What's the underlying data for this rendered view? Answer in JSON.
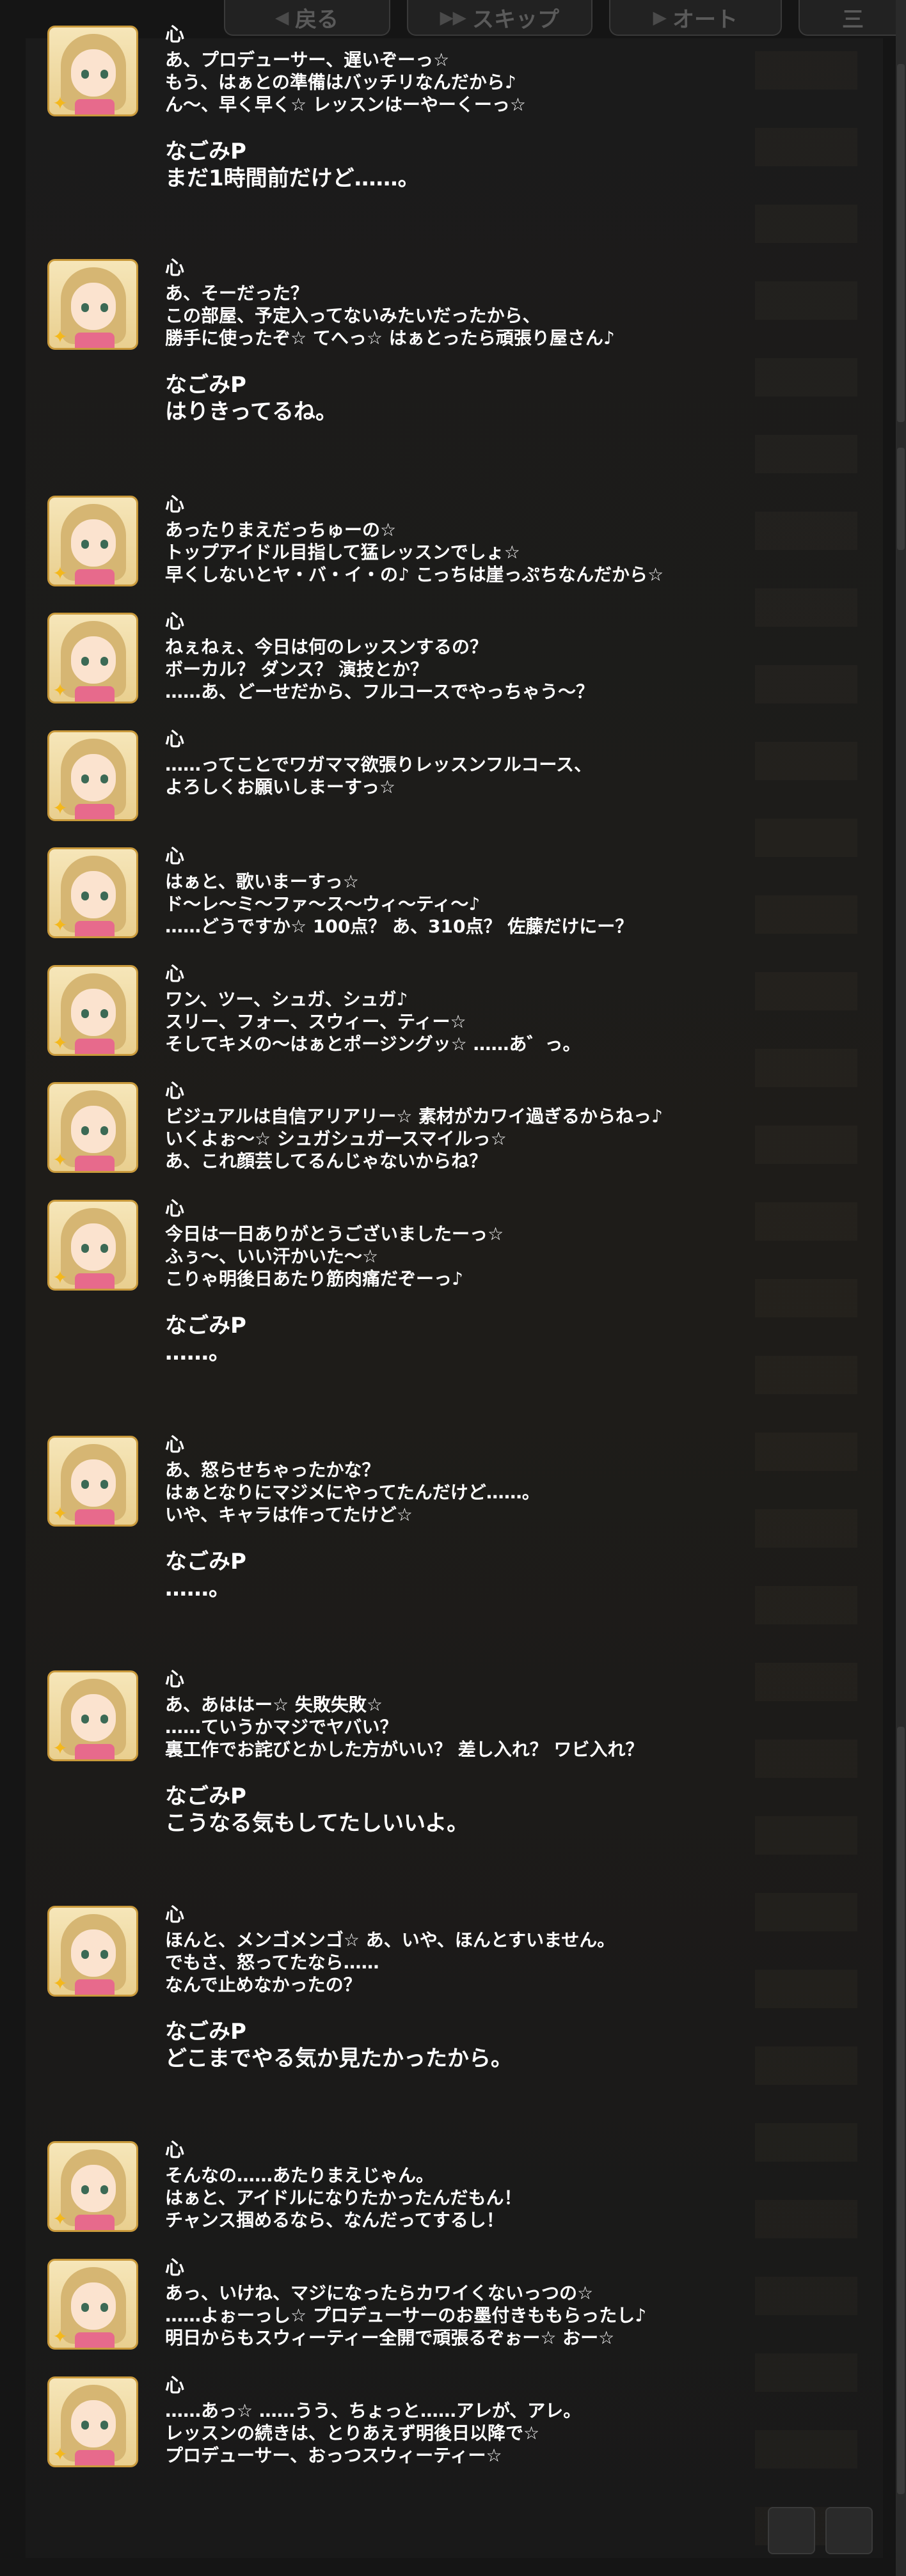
{
  "toolbar": {
    "back_label": "戻る",
    "skip_label": "スキップ",
    "auto_label": "オート",
    "menu_label": "三",
    "back_icon": "back-arrow-icon",
    "skip_icon": "skip-forward-icon",
    "auto_icon": "play-icon"
  },
  "log": [
    {
      "speaker": "心",
      "lines": [
        "あ、プロデューサー、遅いぞーっ☆",
        "もう、はぁとの準備はバッチリなんだから♪",
        "ん～、早く早く☆ レッスンはーやーくーっ☆"
      ],
      "reply": {
        "speaker": "なごみP",
        "lines": [
          "まだ1時間前だけど……。"
        ]
      }
    },
    {
      "speaker": "心",
      "lines": [
        "あ、そーだった？",
        "この部屋、予定入ってないみたいだったから、",
        "勝手に使ったぞ☆ てへっ☆ はぁとったら頑張り屋さん♪"
      ],
      "reply": {
        "speaker": "なごみP",
        "lines": [
          "はりきってるね。"
        ]
      }
    },
    {
      "speaker": "心",
      "lines": [
        "あったりまえだっちゅーの☆",
        "トップアイドル目指して猛レッスンでしょ☆",
        "早くしないとヤ・バ・イ・の♪ こっちは崖っぷちなんだから☆"
      ]
    },
    {
      "speaker": "心",
      "lines": [
        "ねぇねぇ、今日は何のレッスンするの？",
        "ボーカル？ ダンス？ 演技とか？",
        "……あ、どーせだから、フルコースでやっちゃう～？"
      ]
    },
    {
      "speaker": "心",
      "lines": [
        "……ってことでワガママ欲張りレッスンフルコース、",
        "よろしくお願いしまーすっ☆"
      ]
    },
    {
      "speaker": "心",
      "lines": [
        "はぁと、歌いまーすっ☆",
        "ド～レ～ミ～ファ～ス～ウィ～ティ～♪",
        "……どうですか☆ 100点？ あ、310点？ 佐藤だけにー？"
      ]
    },
    {
      "speaker": "心",
      "lines": [
        "ワン、ツー、シュガ、シュガ♪",
        "スリー、フォー、スウィー、ティー☆",
        "そしてキメの～はぁとポージングッ☆ ……あ゛っ。"
      ]
    },
    {
      "speaker": "心",
      "lines": [
        "ビジュアルは自信アリアリー☆ 素材がカワイ過ぎるからねっ♪",
        "いくよぉ～☆ シュガシュガースマイルっ☆",
        "あ、これ顔芸してるんじゃないからね？"
      ]
    },
    {
      "speaker": "心",
      "lines": [
        "今日は一日ありがとうございましたーっ☆",
        "ふぅ～、いい汗かいた～☆",
        "こりゃ明後日あたり筋肉痛だぞーっ♪"
      ],
      "reply": {
        "speaker": "なごみP",
        "lines": [
          "……。"
        ]
      }
    },
    {
      "speaker": "心",
      "lines": [
        "あ、怒らせちゃったかな？",
        "はぁとなりにマジメにやってたんだけど……。",
        "いや、キャラは作ってたけど☆"
      ],
      "reply": {
        "speaker": "なごみP",
        "lines": [
          "……。"
        ]
      }
    },
    {
      "speaker": "心",
      "lines": [
        "あ、あははー☆ 失敗失敗☆",
        "……ていうかマジでヤバい？",
        "裏工作でお詫びとかした方がいい？ 差し入れ？ ワビ入れ？"
      ],
      "reply": {
        "speaker": "なごみP",
        "lines": [
          "こうなる気もしてたしいいよ。"
        ]
      }
    },
    {
      "speaker": "心",
      "lines": [
        "ほんと、メンゴメンゴ☆ あ、いや、ほんとすいません。",
        "でもさ、怒ってたなら……",
        "なんで止めなかったの？"
      ],
      "reply": {
        "speaker": "なごみP",
        "lines": [
          "どこまでやる気か見たかったから。"
        ]
      }
    },
    {
      "speaker": "心",
      "lines": [
        "そんなの……あたりまえじゃん。",
        "はぁと、アイドルになりたかったんだもん！",
        "チャンス掴めるなら、なんだってするし！"
      ]
    },
    {
      "speaker": "心",
      "lines": [
        "あっ、いけね、マジになったらカワイくないっつの☆",
        "……よぉーっし☆ プロデューサーのお墨付きももらったし♪",
        "明日からもスウィーティー全開で頑張るぞぉー☆ おー☆"
      ]
    },
    {
      "speaker": "心",
      "lines": [
        "……あっ☆ ……うう、ちょっと……アレが、アレ。",
        "レッスンの続きは、とりあえず明後日以降で☆",
        "プロデューサー、おっつスウィーティー☆"
      ]
    }
  ]
}
